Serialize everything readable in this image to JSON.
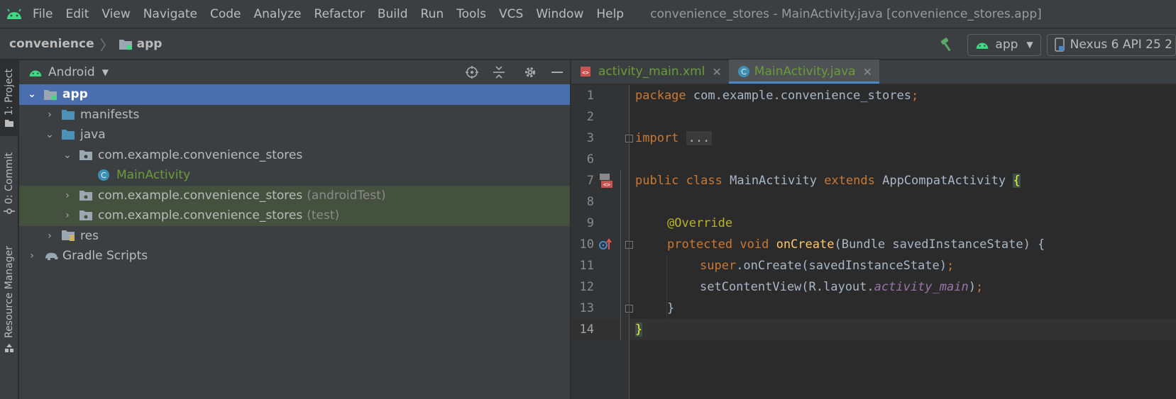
{
  "menubar": {
    "items": [
      {
        "label": "File"
      },
      {
        "label": "Edit"
      },
      {
        "label": "View"
      },
      {
        "label": "Navigate"
      },
      {
        "label": "Code"
      },
      {
        "label": "Analyze"
      },
      {
        "label": "Refactor"
      },
      {
        "label": "Build"
      },
      {
        "label": "Run"
      },
      {
        "label": "Tools"
      },
      {
        "label": "VCS"
      },
      {
        "label": "Window"
      },
      {
        "label": "Help"
      }
    ],
    "window_title": "convenience_stores - MainActivity.java [convenience_stores.app]"
  },
  "navbar": {
    "project": "convenience",
    "module": "app",
    "run_config": "app",
    "device": "Nexus 6 API 25 2"
  },
  "left_strip": {
    "project_tab": "1: Project",
    "commit_tab": "0: Commit",
    "resource_tab": "Resource Manager"
  },
  "project_panel": {
    "view_mode": "Android",
    "tree": [
      {
        "label": "app",
        "suffix": ""
      },
      {
        "label": "manifests",
        "suffix": ""
      },
      {
        "label": "java",
        "suffix": ""
      },
      {
        "label": "com.example.convenience_stores",
        "suffix": ""
      },
      {
        "label": "MainActivity",
        "suffix": ""
      },
      {
        "label": "com.example.convenience_stores",
        "suffix": "(androidTest)"
      },
      {
        "label": "com.example.convenience_stores",
        "suffix": "(test)"
      },
      {
        "label": "res",
        "suffix": ""
      },
      {
        "label": "Gradle Scripts",
        "suffix": ""
      }
    ]
  },
  "editor": {
    "tabs": [
      {
        "label": "activity_main.xml",
        "active": false
      },
      {
        "label": "MainActivity.java",
        "active": true
      }
    ],
    "line_numbers": [
      "1",
      "2",
      "3",
      "6",
      "7",
      "8",
      "9",
      "10",
      "11",
      "12",
      "13",
      "14"
    ],
    "code": {
      "l1_kw": "package",
      "l1_rest": " com.example.convenience_stores",
      "l1_semi": ";",
      "l3_kw": "import",
      "l3_fold": "...",
      "l7_kw1": "public",
      "l7_kw2": "class",
      "l7_name": "MainActivity",
      "l7_kw3": "extends",
      "l7_super": "AppCompatActivity",
      "l7_brace": "{",
      "l9_ann": "@Override",
      "l10_kw1": "protected",
      "l10_kw2": "void",
      "l10_fn": "onCreate",
      "l10_params": "(Bundle savedInstanceState) {",
      "l11_kw": "super",
      "l11_rest": ".onCreate(savedInstanceState)",
      "l11_semi": ";",
      "l12_a": "setContentView(R.layout.",
      "l12_it": "activity_main",
      "l12_b": ")",
      "l12_semi": ";",
      "l13": "}",
      "l14_brace": "}"
    }
  },
  "colors": {
    "accent": "#4a88c7",
    "selection": "#4b6eaf",
    "keyword": "#cc7832",
    "method": "#ffc66d",
    "annotation": "#bbb529",
    "green_file": "#6a9b3b"
  }
}
